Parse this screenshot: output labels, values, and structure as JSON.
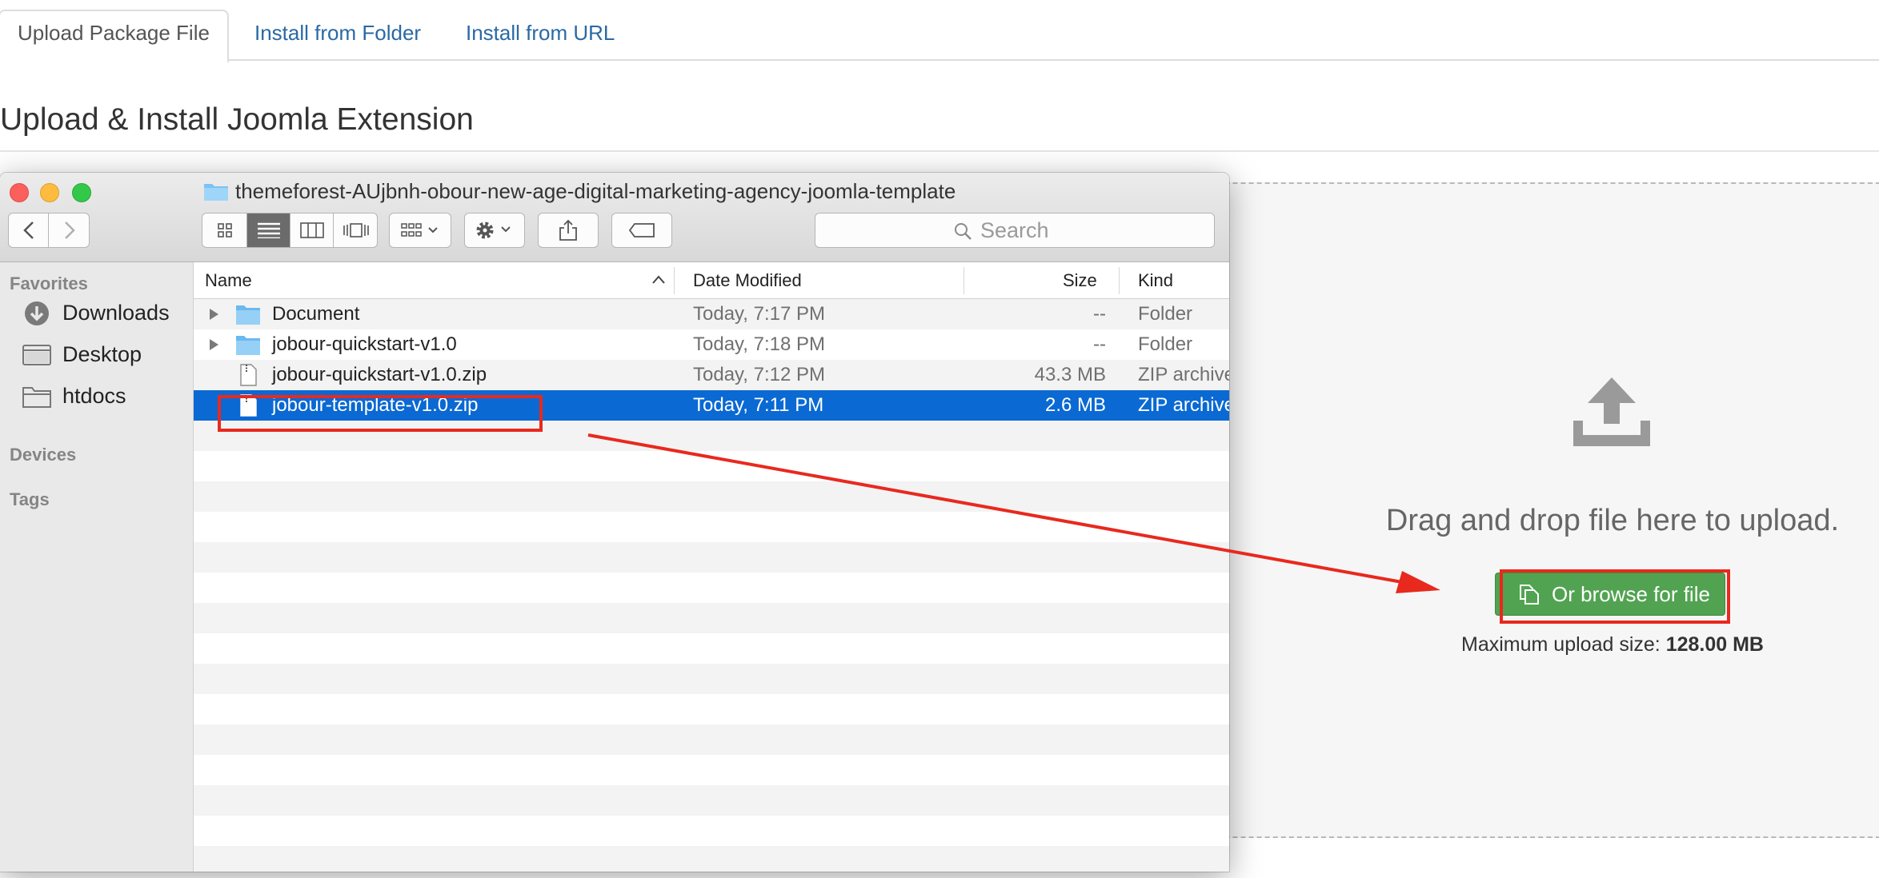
{
  "tabs": [
    {
      "label": "Upload Package File",
      "active": true
    },
    {
      "label": "Install from Folder",
      "active": false
    },
    {
      "label": "Install from URL",
      "active": false
    }
  ],
  "page_title": "Upload & Install Joomla Extension",
  "upload": {
    "drop_text": "Drag and drop file here to upload.",
    "browse_label": "Or browse for file",
    "max_label": "Maximum upload size:",
    "max_value": "128.00 MB",
    "icon": "upload-icon",
    "button_color": "#51a351"
  },
  "finder": {
    "title": "themeforest-AUjbnh-obour-new-age-digital-marketing-agency-joomla-template",
    "search_placeholder": "Search",
    "sidebar": {
      "favorites_heading": "Favorites",
      "favorites": [
        {
          "label": "Downloads",
          "icon": "downloads-icon"
        },
        {
          "label": "Desktop",
          "icon": "desktop-icon"
        },
        {
          "label": "htdocs",
          "icon": "folder-icon"
        }
      ],
      "devices_heading": "Devices",
      "tags_heading": "Tags"
    },
    "columns": {
      "name": "Name",
      "date": "Date Modified",
      "size": "Size",
      "kind": "Kind"
    },
    "files": [
      {
        "name": "Document",
        "date": "Today, 7:17 PM",
        "size": "--",
        "kind": "Folder",
        "type": "folder"
      },
      {
        "name": "jobour-quickstart-v1.0",
        "date": "Today, 7:18 PM",
        "size": "--",
        "kind": "Folder",
        "type": "folder"
      },
      {
        "name": "jobour-quickstart-v1.0.zip",
        "date": "Today, 7:12 PM",
        "size": "43.3 MB",
        "kind": "ZIP archive",
        "type": "zip"
      },
      {
        "name": "jobour-template-v1.0.zip",
        "date": "Today, 7:11 PM",
        "size": "2.6 MB",
        "kind": "ZIP archive",
        "type": "zip",
        "selected": true
      }
    ],
    "selection_color": "#0a69d3"
  },
  "annotation_color": "#e8291e"
}
